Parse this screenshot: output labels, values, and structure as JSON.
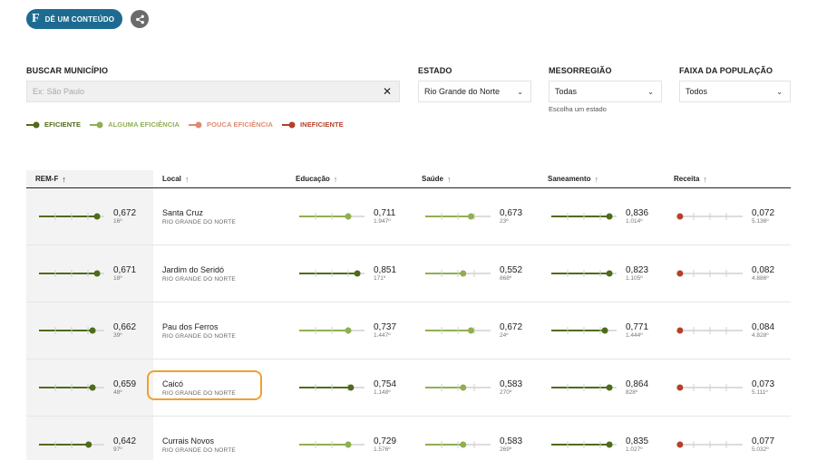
{
  "toolbar": {
    "content_button_logo": "F",
    "content_button_label": "DÊ UM CONTEÚDO",
    "share_icon": "share-icon"
  },
  "filters": {
    "search": {
      "label": "BUSCAR MUNICÍPIO",
      "placeholder": "Ex: São Paulo",
      "value": ""
    },
    "estado": {
      "label": "ESTADO",
      "value": "Rio Grande do Norte"
    },
    "mesorregiao": {
      "label": "MESORREGIÃO",
      "value": "Todas",
      "hint": "Escolha um estado"
    },
    "faixa": {
      "label": "FAIXA DA POPULAÇÃO",
      "value": "Todos"
    }
  },
  "legend": [
    {
      "label": "EFICIENTE",
      "color": "#4f6b1a",
      "level": 1.0
    },
    {
      "label": "ALGUMA EFICIÊNCIA",
      "color": "#8eb050",
      "level": 0.66
    },
    {
      "label": "POUCA EFICIÊNCIA",
      "color": "#e08a70",
      "level": 0.33
    },
    {
      "label": "INEFICIENTE",
      "color": "#b5402a",
      "level": 0.0
    }
  ],
  "columns": [
    {
      "label": "REM-F",
      "arrow": "↑"
    },
    {
      "label": "Local",
      "arrow": "↑"
    },
    {
      "label": "Educação",
      "arrow": "↑"
    },
    {
      "label": "Saúde",
      "arrow": "↑"
    },
    {
      "label": "Saneamento",
      "arrow": "↑"
    },
    {
      "label": "Receita",
      "arrow": "↑"
    }
  ],
  "rows": [
    {
      "name": "Santa Cruz",
      "state": "RIO GRANDE DO NORTE",
      "remf": {
        "value": "0,672",
        "rank": "16º",
        "level": 0.89,
        "color": "#4f6b1a"
      },
      "educacao": {
        "value": "0,711",
        "rank": "1.947º",
        "level": 0.75,
        "color": "#8eb050"
      },
      "saude": {
        "value": "0,673",
        "rank": "23º",
        "level": 0.7,
        "color": "#8eb050"
      },
      "saneamento": {
        "value": "0,836",
        "rank": "1.014º",
        "level": 0.89,
        "color": "#4f6b1a"
      },
      "receita": {
        "value": "0,072",
        "rank": "5.136º",
        "level": 0.04,
        "color": "#b5402a"
      }
    },
    {
      "name": "Jardim do Seridó",
      "state": "RIO GRANDE DO NORTE",
      "remf": {
        "value": "0,671",
        "rank": "18º",
        "level": 0.89,
        "color": "#4f6b1a"
      },
      "educacao": {
        "value": "0,851",
        "rank": "171º",
        "level": 0.89,
        "color": "#4f6b1a"
      },
      "saude": {
        "value": "0,552",
        "rank": "868º",
        "level": 0.58,
        "color": "#8eb050"
      },
      "saneamento": {
        "value": "0,823",
        "rank": "1.105º",
        "level": 0.89,
        "color": "#4f6b1a"
      },
      "receita": {
        "value": "0,082",
        "rank": "4.886º",
        "level": 0.04,
        "color": "#b5402a"
      }
    },
    {
      "name": "Pau dos Ferros",
      "state": "RIO GRANDE DO NORTE",
      "remf": {
        "value": "0,662",
        "rank": "39º",
        "level": 0.82,
        "color": "#4f6b1a"
      },
      "educacao": {
        "value": "0,737",
        "rank": "1.447º",
        "level": 0.75,
        "color": "#8eb050"
      },
      "saude": {
        "value": "0,672",
        "rank": "24º",
        "level": 0.7,
        "color": "#8eb050"
      },
      "saneamento": {
        "value": "0,771",
        "rank": "1.444º",
        "level": 0.82,
        "color": "#4f6b1a"
      },
      "receita": {
        "value": "0,084",
        "rank": "4.828º",
        "level": 0.04,
        "color": "#b5402a"
      }
    },
    {
      "name": "Caicó",
      "state": "RIO GRANDE DO NORTE",
      "highlighted": true,
      "remf": {
        "value": "0,659",
        "rank": "48º",
        "level": 0.82,
        "color": "#4f6b1a"
      },
      "educacao": {
        "value": "0,754",
        "rank": "1.148º",
        "level": 0.79,
        "color": "#4f6b1a"
      },
      "saude": {
        "value": "0,583",
        "rank": "270º",
        "level": 0.58,
        "color": "#8eb050"
      },
      "saneamento": {
        "value": "0,864",
        "rank": "828º",
        "level": 0.89,
        "color": "#4f6b1a"
      },
      "receita": {
        "value": "0,073",
        "rank": "5.111º",
        "level": 0.04,
        "color": "#b5402a"
      }
    },
    {
      "name": "Currais Novos",
      "state": "RIO GRANDE DO NORTE",
      "remf": {
        "value": "0,642",
        "rank": "97º",
        "level": 0.76,
        "color": "#4f6b1a"
      },
      "educacao": {
        "value": "0,729",
        "rank": "1.576º",
        "level": 0.75,
        "color": "#8eb050"
      },
      "saude": {
        "value": "0,583",
        "rank": "269º",
        "level": 0.58,
        "color": "#8eb050"
      },
      "saneamento": {
        "value": "0,835",
        "rank": "1.027º",
        "level": 0.89,
        "color": "#4f6b1a"
      },
      "receita": {
        "value": "0,077",
        "rank": "5.032º",
        "level": 0.04,
        "color": "#b5402a"
      }
    }
  ]
}
